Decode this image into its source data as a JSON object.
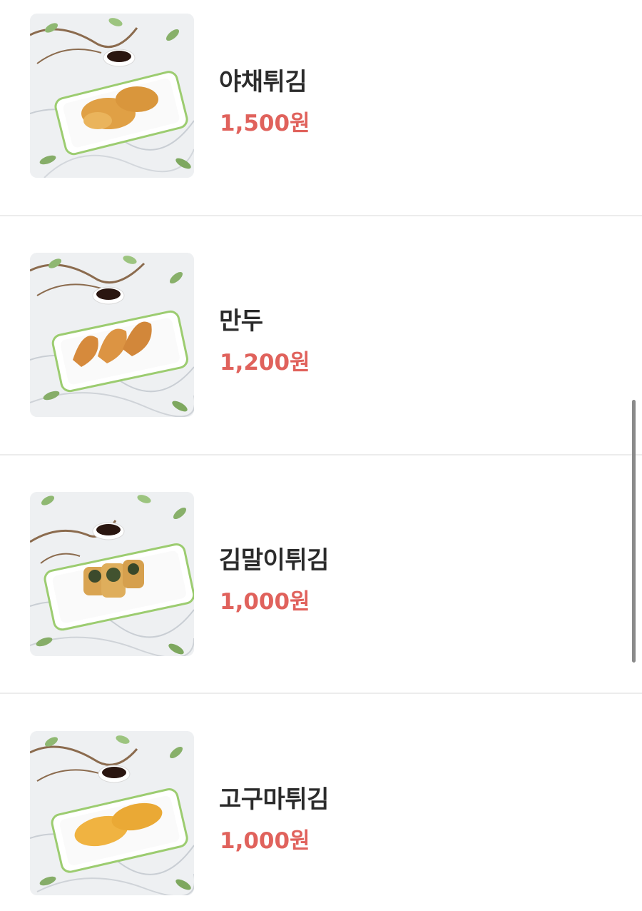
{
  "menu": {
    "items": [
      {
        "name": "야채튀김",
        "price": "1,500원",
        "image": "vegetable-fritter-plate"
      },
      {
        "name": "만두",
        "price": "1,200원",
        "image": "fried-dumpling-plate"
      },
      {
        "name": "김말이튀김",
        "price": "1,000원",
        "image": "seaweed-roll-fritter-plate"
      },
      {
        "name": "고구마튀김",
        "price": "1,000원",
        "image": "sweet-potato-fritter-plate"
      }
    ]
  },
  "colors": {
    "price": "#e0625c",
    "name": "#2b2b2b",
    "divider": "#ececec",
    "scrollbar": "#8a8a8a"
  }
}
